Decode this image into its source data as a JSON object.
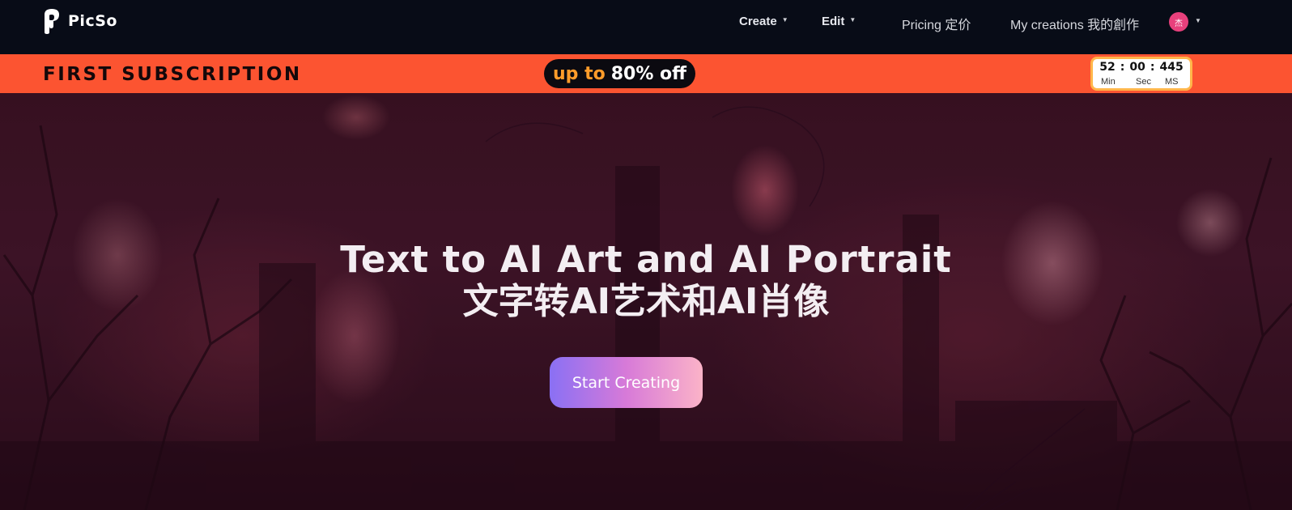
{
  "brand": {
    "name": "PicSo",
    "logo_icon": "picso-logo-icon"
  },
  "nav": {
    "create_label": "Create",
    "edit_label": "Edit",
    "pricing_label": "Pricing 定价",
    "creations_label": "My creations 我的創作",
    "avatar_text": "杰",
    "caret_icon": "caret-down-icon"
  },
  "promo": {
    "title": "FIRST SUBSCRIPTION",
    "discount_prefix": "up to",
    "discount_value": "80% off",
    "timer": {
      "min": "52",
      "sec": "00",
      "ms": "445",
      "sep": ":",
      "min_label": "Min",
      "sec_label": "Sec",
      "ms_label": "MS"
    },
    "colors": {
      "bar": "#fc5431",
      "accent": "#ff9c2a",
      "timer_border": "#ffb64a"
    }
  },
  "hero": {
    "title": "Text to AI Art and AI Portrait",
    "subtitle": "文字转AI艺术和AI肖像",
    "cta_label": "Start Creating",
    "colors": {
      "cta_start": "#8a70f4",
      "cta_end": "#fbb3c8"
    }
  }
}
